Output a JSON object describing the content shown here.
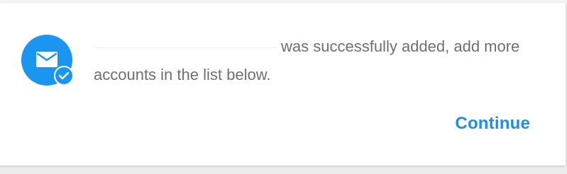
{
  "dialog": {
    "message_suffix": "was successfully added, add more accounts in the list below.",
    "continue_label": "Continue",
    "icon": "mail-check-icon"
  },
  "colors": {
    "accent": "#1a95f0",
    "text": "#6f6f6f",
    "link": "#1a8fe8"
  }
}
